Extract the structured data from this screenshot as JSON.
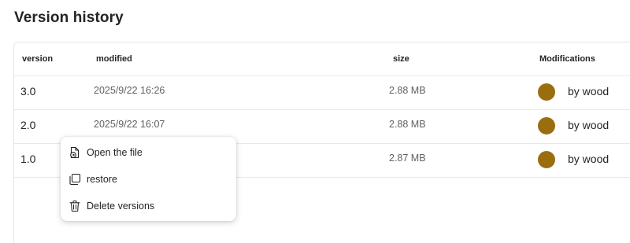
{
  "page": {
    "title": "Version history"
  },
  "table": {
    "headers": {
      "version": "version",
      "modified": "modified",
      "size": "size",
      "modifications": "Modifications"
    },
    "rows": [
      {
        "version": "3.0",
        "modified": "2025/9/22 16:26",
        "size": "2.88 MB",
        "by": "by wood",
        "avatar_color": "#9a6d0f"
      },
      {
        "version": "2.0",
        "modified": "2025/9/22 16:07",
        "size": "2.88 MB",
        "by": "by wood",
        "avatar_color": "#9a6d0f"
      },
      {
        "version": "1.0",
        "modified": "",
        "size": "2.87 MB",
        "by": "by wood",
        "avatar_color": "#9a6d0f"
      }
    ]
  },
  "context_menu": {
    "items": [
      {
        "label": "Open the file",
        "icon": "open-file-icon"
      },
      {
        "label": "restore",
        "icon": "restore-icon"
      },
      {
        "label": "Delete versions",
        "icon": "trash-icon"
      }
    ]
  }
}
